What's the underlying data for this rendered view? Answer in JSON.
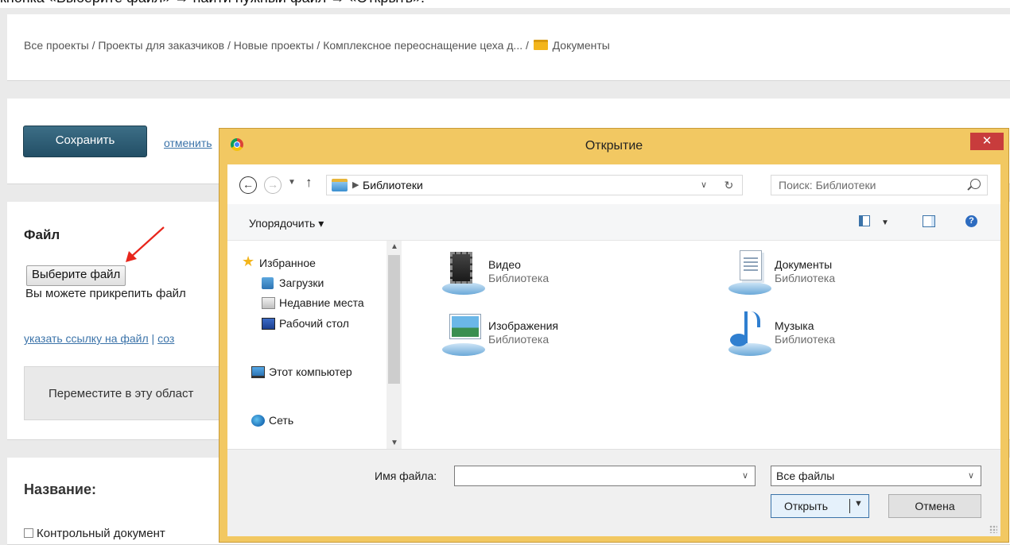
{
  "top_strip_text": "кнопка «Выберите файл» → найти нужный файл → «Открыть».",
  "breadcrumb": {
    "path": "Все проекты / Проекты для заказчиков / Новые проекты / Комплексное переоснащение цеха д... / ",
    "current": "Документы"
  },
  "actions": {
    "save_label": "Сохранить",
    "cancel_label": "отменить"
  },
  "file_section": {
    "heading": "Файл",
    "choose_label": "Выберите файл",
    "hint": "Вы можете прикрепить файл",
    "link_url": "указать ссылку на файл",
    "link_sep": " | ",
    "link_create": "соз",
    "drop_text": "Переместите в эту област"
  },
  "name_section": {
    "heading": "Название:",
    "checkbox_label": "Контрольный документ"
  },
  "dialog": {
    "title": "Открытие",
    "close_label": "✕",
    "address": "Библиотеки",
    "search_placeholder": "Поиск: Библиотеки",
    "organize_label": "Упорядочить ▾",
    "nav": {
      "favorites": "Избранное",
      "downloads": "Загрузки",
      "recent": "Недавние места",
      "desktop": "Рабочий стол",
      "computer": "Этот компьютер",
      "network": "Сеть"
    },
    "libraries": [
      {
        "name": "Видео",
        "type": "Библиотека",
        "icon": "video-library-icon"
      },
      {
        "name": "Документы",
        "type": "Библиотека",
        "icon": "documents-library-icon"
      },
      {
        "name": "Изображения",
        "type": "Библиотека",
        "icon": "pictures-library-icon"
      },
      {
        "name": "Музыка",
        "type": "Библиотека",
        "icon": "music-library-icon"
      }
    ],
    "filename_label": "Имя файла:",
    "filename_value": "",
    "filter_value": "Все файлы",
    "open_label": "Открыть",
    "cancel_label": "Отмена"
  },
  "colors": {
    "dialog_frame": "#f2c862",
    "close_button": "#c83c3c",
    "save_button": "#2c5a71",
    "link": "#3b73a9",
    "annotation_arrow": "#e8261c"
  }
}
